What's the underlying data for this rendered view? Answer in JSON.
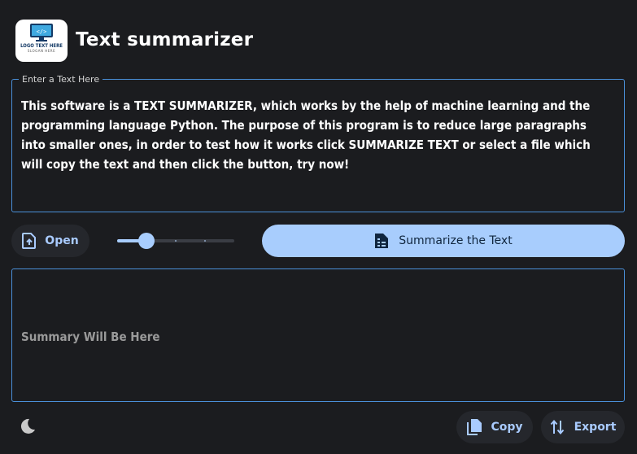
{
  "header": {
    "title": "Text summarizer",
    "logo": {
      "line1": "LOGO TEXT HERE",
      "line2": "SLOGAN HERE"
    }
  },
  "input": {
    "legend": "Enter a Text Here",
    "value": "This software is a TEXT SUMMARIZER, which works by the help of machine learning and the programming language Python. The purpose of this program is to reduce large paragraphs into smaller ones, in order to test how it works click SUMMARIZE TEXT or select a file which will copy the text and then click the button, try now!"
  },
  "controls": {
    "open_label": "Open",
    "summarize_label": "Summarize the Text",
    "slider": {
      "value": 0.25,
      "steps": 4
    }
  },
  "output": {
    "placeholder": "Summary Will Be Here"
  },
  "footer": {
    "copy_label": "Copy",
    "export_label": "Export"
  },
  "icons": {
    "logo": "monitor-code-icon",
    "open": "file-upload-icon",
    "summarize": "document-list-icon",
    "theme": "moon-icon",
    "copy": "copy-icon",
    "export": "sort-arrows-icon"
  },
  "colors": {
    "background": "#1b1c1f",
    "accent": "#a8cdfd",
    "border": "#4a8fd8",
    "button_bg": "#25272c"
  }
}
